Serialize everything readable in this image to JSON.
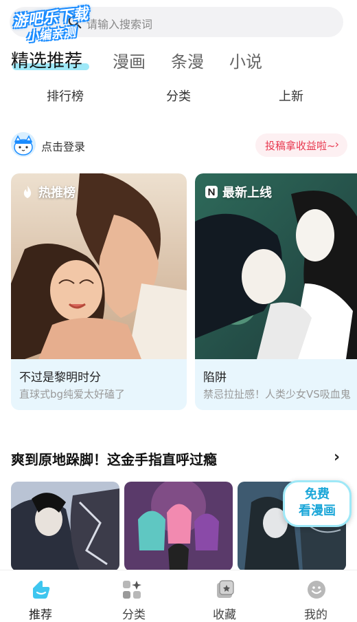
{
  "watermark": {
    "line1": "游吧乐下载",
    "line2": "小编亲测"
  },
  "search": {
    "placeholder": "请输入搜索词"
  },
  "top_tabs": [
    {
      "label": "精选推荐",
      "active": true
    },
    {
      "label": "漫画",
      "active": false
    },
    {
      "label": "条漫",
      "active": false
    },
    {
      "label": "小说",
      "active": false
    }
  ],
  "sub_tabs": [
    {
      "label": "排行榜"
    },
    {
      "label": "分类"
    },
    {
      "label": "上新"
    }
  ],
  "login": {
    "text": "点击登录",
    "contribute": "投稿拿收益啦~"
  },
  "cards": [
    {
      "badge": "热推榜",
      "badge_icon": "flame-icon",
      "title": "不过是黎明时分",
      "subtitle": "直球式bg纯爱太好磕了"
    },
    {
      "badge": "最新上线",
      "badge_icon": "new-n-icon",
      "title": "陷阱",
      "subtitle": "禁忌拉扯感！人类少女VS吸血鬼"
    }
  ],
  "section": {
    "title": "爽到原地跺脚！这金手指直呼过瘾"
  },
  "free_badge": {
    "line1": "免费",
    "line2": "看漫画"
  },
  "bottom_nav": [
    {
      "label": "推荐",
      "icon": "home-recommend-icon",
      "active": true
    },
    {
      "label": "分类",
      "icon": "category-icon",
      "active": false
    },
    {
      "label": "收藏",
      "icon": "collection-icon",
      "active": false
    },
    {
      "label": "我的",
      "icon": "profile-smile-icon",
      "active": false
    }
  ],
  "colors": {
    "accent": "#9ee8f7",
    "contribute_text": "#e8384f",
    "card_bg": "#e8f6fd",
    "nav_active": "#3ec6ef"
  }
}
